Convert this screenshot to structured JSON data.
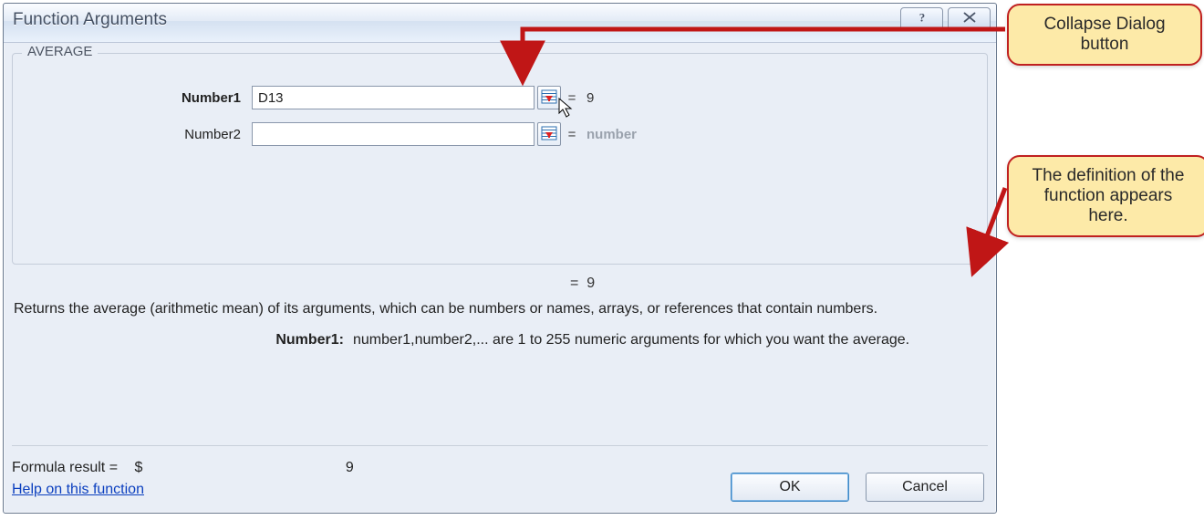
{
  "dialog": {
    "title": "Function Arguments",
    "help_button_tooltip": "Help",
    "close_button_tooltip": "Close"
  },
  "group": {
    "legend": "AVERAGE"
  },
  "args": [
    {
      "label": "Number1",
      "label_bold": true,
      "value": "D13",
      "placeholder": "",
      "result": "9",
      "result_dim": false
    },
    {
      "label": "Number2",
      "label_bold": false,
      "value": "",
      "placeholder": "",
      "result": "number",
      "result_dim": true
    }
  ],
  "mid": {
    "overall_eq_prefix": "=",
    "overall_value": "9",
    "description": "Returns the average (arithmetic mean) of its arguments, which can be numbers or names, arrays, or references that contain numbers.",
    "arg_name": "Number1:",
    "arg_text": "number1,number2,... are 1 to 255 numeric arguments for which you want the average."
  },
  "result": {
    "label": "Formula result =",
    "currency": "$",
    "value": "9"
  },
  "help_link": "Help on this function",
  "buttons": {
    "ok": "OK",
    "cancel": "Cancel"
  },
  "callouts": {
    "collapse": "Collapse Dialog button",
    "definition": "The definition of the function appears here."
  },
  "icons": {
    "collapse_dialog": "collapse-dialog-icon",
    "help": "help-icon",
    "close": "close-icon"
  }
}
